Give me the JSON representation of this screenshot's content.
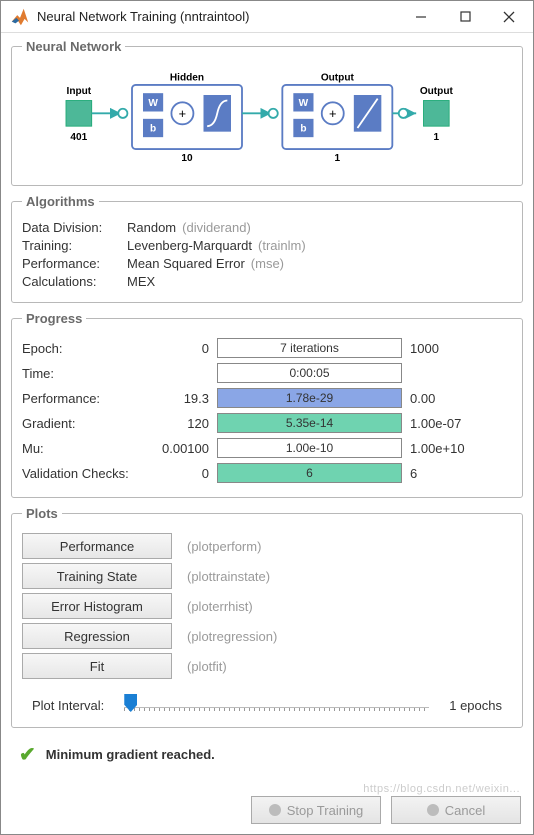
{
  "window": {
    "title": "Neural Network Training (nntraintool)"
  },
  "sections": {
    "network": "Neural Network",
    "algorithms": "Algorithms",
    "progress": "Progress",
    "plots": "Plots"
  },
  "diagram": {
    "input_label": "Input",
    "input_size": "401",
    "hidden_label": "Hidden",
    "hidden_size": "10",
    "output_label": "Output",
    "output_size": "1",
    "final_label": "Output",
    "final_size": "1",
    "w": "W",
    "b": "b",
    "plus": "+"
  },
  "algorithms": {
    "data_division": {
      "label": "Data Division:",
      "value": "Random",
      "func": "(dividerand)"
    },
    "training": {
      "label": "Training:",
      "value": "Levenberg-Marquardt",
      "func": "(trainlm)"
    },
    "performance": {
      "label": "Performance:",
      "value": "Mean Squared Error",
      "func": "(mse)"
    },
    "calculations": {
      "label": "Calculations:",
      "value": "MEX"
    }
  },
  "progress": {
    "epoch": {
      "label": "Epoch:",
      "start": "0",
      "text": "7 iterations",
      "end": "1000",
      "fill_pct": 0,
      "color": "#8aa6e6"
    },
    "time": {
      "label": "Time:",
      "start": "",
      "text": "0:00:05",
      "end": "",
      "fill_pct": 0,
      "color": "#fff"
    },
    "performance": {
      "label": "Performance:",
      "start": "19.3",
      "text": "1.78e-29",
      "end": "0.00",
      "fill_pct": 100,
      "color": "#8aa6e6"
    },
    "gradient": {
      "label": "Gradient:",
      "start": "120",
      "text": "5.35e-14",
      "end": "1.00e-07",
      "fill_pct": 100,
      "color": "#6fd3b0"
    },
    "mu": {
      "label": "Mu:",
      "start": "0.00100",
      "text": "1.00e-10",
      "end": "1.00e+10",
      "fill_pct": 0,
      "color": "#fff"
    },
    "validation": {
      "label": "Validation Checks:",
      "start": "0",
      "text": "6",
      "end": "6",
      "fill_pct": 100,
      "color": "#6fd3b0"
    }
  },
  "plots": {
    "performance": {
      "label": "Performance",
      "func": "(plotperform)"
    },
    "training_state": {
      "label": "Training State",
      "func": "(plottrainstate)"
    },
    "error_histogram": {
      "label": "Error Histogram",
      "func": "(ploterrhist)"
    },
    "regression": {
      "label": "Regression",
      "func": "(plotregression)"
    },
    "fit": {
      "label": "Fit",
      "func": "(plotfit)"
    },
    "interval": {
      "label": "Plot Interval:",
      "value": "1 epochs"
    }
  },
  "status": {
    "text": "Minimum gradient reached."
  },
  "buttons": {
    "stop": "Stop Training",
    "cancel": "Cancel"
  },
  "watermark": "https://blog.csdn.net/weixin..."
}
